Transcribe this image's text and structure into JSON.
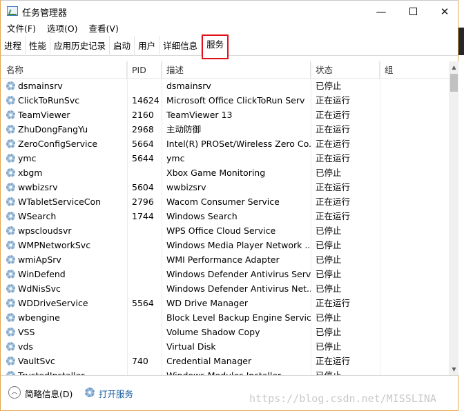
{
  "window": {
    "title": "任务管理器",
    "minimize": "—",
    "close": "✕"
  },
  "menu": [
    "文件(F)",
    "选项(O)",
    "查看(V)"
  ],
  "tabs": [
    "进程",
    "性能",
    "应用历史记录",
    "启动",
    "用户",
    "详细信息",
    "服务"
  ],
  "active_tab": "服务",
  "columns": {
    "name": "名称",
    "pid": "PID",
    "desc": "描述",
    "status": "状态",
    "group": "组"
  },
  "services": [
    {
      "name": "dsmainsrv",
      "pid": "",
      "desc": "dsmainsrv",
      "status": "已停止"
    },
    {
      "name": "ClickToRunSvc",
      "pid": "14624",
      "desc": "Microsoft Office ClickToRun Serv",
      "status": "正在运行"
    },
    {
      "name": "TeamViewer",
      "pid": "2160",
      "desc": "TeamViewer 13",
      "status": "正在运行"
    },
    {
      "name": "ZhuDongFangYu",
      "pid": "2968",
      "desc": "主动防御",
      "status": "正在运行"
    },
    {
      "name": "ZeroConfigService",
      "pid": "5664",
      "desc": "Intel(R) PROSet/Wireless Zero Co...",
      "status": "正在运行"
    },
    {
      "name": "ymc",
      "pid": "5644",
      "desc": "ymc",
      "status": "正在运行"
    },
    {
      "name": "xbgm",
      "pid": "",
      "desc": "Xbox Game Monitoring",
      "status": "已停止"
    },
    {
      "name": "wwbizsrv",
      "pid": "5604",
      "desc": "wwbizsrv",
      "status": "正在运行"
    },
    {
      "name": "WTabletServiceCon",
      "pid": "2796",
      "desc": "Wacom Consumer Service",
      "status": "正在运行"
    },
    {
      "name": "WSearch",
      "pid": "1744",
      "desc": "Windows Search",
      "status": "正在运行"
    },
    {
      "name": "wpscloudsvr",
      "pid": "",
      "desc": "WPS Office Cloud Service",
      "status": "已停止"
    },
    {
      "name": "WMPNetworkSvc",
      "pid": "",
      "desc": "Windows Media Player Network ...",
      "status": "已停止"
    },
    {
      "name": "wmiApSrv",
      "pid": "",
      "desc": "WMI Performance Adapter",
      "status": "已停止"
    },
    {
      "name": "WinDefend",
      "pid": "",
      "desc": "Windows Defender Antivirus Serv",
      "status": "已停止"
    },
    {
      "name": "WdNisSvc",
      "pid": "",
      "desc": "Windows Defender Antivirus Net...",
      "status": "已停止"
    },
    {
      "name": "WDDriveService",
      "pid": "5564",
      "desc": "WD Drive Manager",
      "status": "正在运行"
    },
    {
      "name": "wbengine",
      "pid": "",
      "desc": "Block Level Backup Engine Service",
      "status": "已停止"
    },
    {
      "name": "VSS",
      "pid": "",
      "desc": "Volume Shadow Copy",
      "status": "已停止"
    },
    {
      "name": "vds",
      "pid": "",
      "desc": "Virtual Disk",
      "status": "已停止"
    },
    {
      "name": "VaultSvc",
      "pid": "740",
      "desc": "Credential Manager",
      "status": "正在运行"
    },
    {
      "name": "TrustedInstaller",
      "pid": "",
      "desc": "Windows Modules Installer",
      "status": "已停止"
    }
  ],
  "footer": {
    "fewer_details": "简略信息(D)",
    "open_services": "打开服务",
    "watermark": "https://blog.csdn.net/MISSLINA"
  }
}
